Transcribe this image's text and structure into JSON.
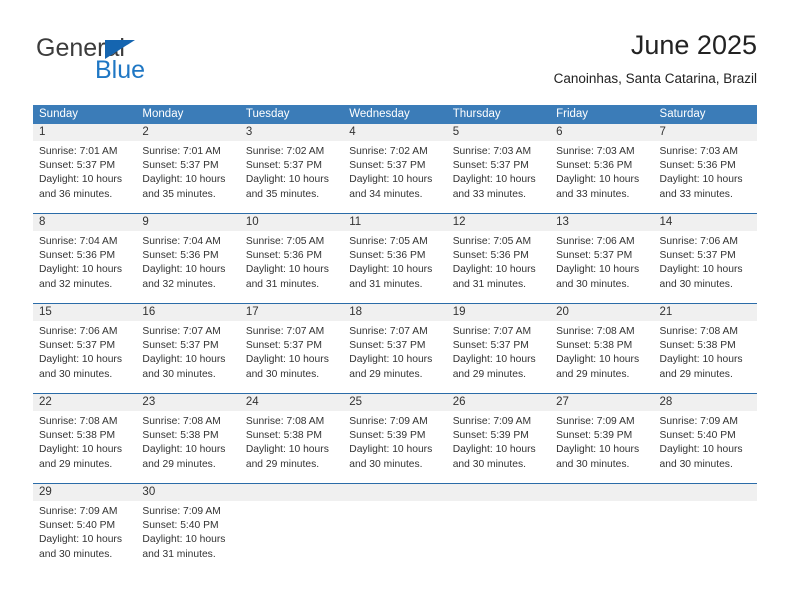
{
  "branding": {
    "logo_primary": "General",
    "logo_secondary": "Blue",
    "triangle_icon": "triangle-icon",
    "primary_color": "#3c3c3c",
    "accent_color": "#1f77c4"
  },
  "header": {
    "title": "June 2025",
    "subtitle": "Canoinhas, Santa Catarina, Brazil"
  },
  "theme": {
    "header_bar_color": "#3b7cb8",
    "week_separator_color": "#2b6ca8",
    "day_strip_color": "#f0f0f0",
    "text_color": "#333333"
  },
  "weekdays": [
    "Sunday",
    "Monday",
    "Tuesday",
    "Wednesday",
    "Thursday",
    "Friday",
    "Saturday"
  ],
  "weeks": [
    [
      {
        "day": "1",
        "sunrise": "Sunrise: 7:01 AM",
        "sunset": "Sunset: 5:37 PM",
        "daylight_line1": "Daylight: 10 hours",
        "daylight_line2": "and 36 minutes."
      },
      {
        "day": "2",
        "sunrise": "Sunrise: 7:01 AM",
        "sunset": "Sunset: 5:37 PM",
        "daylight_line1": "Daylight: 10 hours",
        "daylight_line2": "and 35 minutes."
      },
      {
        "day": "3",
        "sunrise": "Sunrise: 7:02 AM",
        "sunset": "Sunset: 5:37 PM",
        "daylight_line1": "Daylight: 10 hours",
        "daylight_line2": "and 35 minutes."
      },
      {
        "day": "4",
        "sunrise": "Sunrise: 7:02 AM",
        "sunset": "Sunset: 5:37 PM",
        "daylight_line1": "Daylight: 10 hours",
        "daylight_line2": "and 34 minutes."
      },
      {
        "day": "5",
        "sunrise": "Sunrise: 7:03 AM",
        "sunset": "Sunset: 5:37 PM",
        "daylight_line1": "Daylight: 10 hours",
        "daylight_line2": "and 33 minutes."
      },
      {
        "day": "6",
        "sunrise": "Sunrise: 7:03 AM",
        "sunset": "Sunset: 5:36 PM",
        "daylight_line1": "Daylight: 10 hours",
        "daylight_line2": "and 33 minutes."
      },
      {
        "day": "7",
        "sunrise": "Sunrise: 7:03 AM",
        "sunset": "Sunset: 5:36 PM",
        "daylight_line1": "Daylight: 10 hours",
        "daylight_line2": "and 33 minutes."
      }
    ],
    [
      {
        "day": "8",
        "sunrise": "Sunrise: 7:04 AM",
        "sunset": "Sunset: 5:36 PM",
        "daylight_line1": "Daylight: 10 hours",
        "daylight_line2": "and 32 minutes."
      },
      {
        "day": "9",
        "sunrise": "Sunrise: 7:04 AM",
        "sunset": "Sunset: 5:36 PM",
        "daylight_line1": "Daylight: 10 hours",
        "daylight_line2": "and 32 minutes."
      },
      {
        "day": "10",
        "sunrise": "Sunrise: 7:05 AM",
        "sunset": "Sunset: 5:36 PM",
        "daylight_line1": "Daylight: 10 hours",
        "daylight_line2": "and 31 minutes."
      },
      {
        "day": "11",
        "sunrise": "Sunrise: 7:05 AM",
        "sunset": "Sunset: 5:36 PM",
        "daylight_line1": "Daylight: 10 hours",
        "daylight_line2": "and 31 minutes."
      },
      {
        "day": "12",
        "sunrise": "Sunrise: 7:05 AM",
        "sunset": "Sunset: 5:36 PM",
        "daylight_line1": "Daylight: 10 hours",
        "daylight_line2": "and 31 minutes."
      },
      {
        "day": "13",
        "sunrise": "Sunrise: 7:06 AM",
        "sunset": "Sunset: 5:37 PM",
        "daylight_line1": "Daylight: 10 hours",
        "daylight_line2": "and 30 minutes."
      },
      {
        "day": "14",
        "sunrise": "Sunrise: 7:06 AM",
        "sunset": "Sunset: 5:37 PM",
        "daylight_line1": "Daylight: 10 hours",
        "daylight_line2": "and 30 minutes."
      }
    ],
    [
      {
        "day": "15",
        "sunrise": "Sunrise: 7:06 AM",
        "sunset": "Sunset: 5:37 PM",
        "daylight_line1": "Daylight: 10 hours",
        "daylight_line2": "and 30 minutes."
      },
      {
        "day": "16",
        "sunrise": "Sunrise: 7:07 AM",
        "sunset": "Sunset: 5:37 PM",
        "daylight_line1": "Daylight: 10 hours",
        "daylight_line2": "and 30 minutes."
      },
      {
        "day": "17",
        "sunrise": "Sunrise: 7:07 AM",
        "sunset": "Sunset: 5:37 PM",
        "daylight_line1": "Daylight: 10 hours",
        "daylight_line2": "and 30 minutes."
      },
      {
        "day": "18",
        "sunrise": "Sunrise: 7:07 AM",
        "sunset": "Sunset: 5:37 PM",
        "daylight_line1": "Daylight: 10 hours",
        "daylight_line2": "and 29 minutes."
      },
      {
        "day": "19",
        "sunrise": "Sunrise: 7:07 AM",
        "sunset": "Sunset: 5:37 PM",
        "daylight_line1": "Daylight: 10 hours",
        "daylight_line2": "and 29 minutes."
      },
      {
        "day": "20",
        "sunrise": "Sunrise: 7:08 AM",
        "sunset": "Sunset: 5:38 PM",
        "daylight_line1": "Daylight: 10 hours",
        "daylight_line2": "and 29 minutes."
      },
      {
        "day": "21",
        "sunrise": "Sunrise: 7:08 AM",
        "sunset": "Sunset: 5:38 PM",
        "daylight_line1": "Daylight: 10 hours",
        "daylight_line2": "and 29 minutes."
      }
    ],
    [
      {
        "day": "22",
        "sunrise": "Sunrise: 7:08 AM",
        "sunset": "Sunset: 5:38 PM",
        "daylight_line1": "Daylight: 10 hours",
        "daylight_line2": "and 29 minutes."
      },
      {
        "day": "23",
        "sunrise": "Sunrise: 7:08 AM",
        "sunset": "Sunset: 5:38 PM",
        "daylight_line1": "Daylight: 10 hours",
        "daylight_line2": "and 29 minutes."
      },
      {
        "day": "24",
        "sunrise": "Sunrise: 7:08 AM",
        "sunset": "Sunset: 5:38 PM",
        "daylight_line1": "Daylight: 10 hours",
        "daylight_line2": "and 29 minutes."
      },
      {
        "day": "25",
        "sunrise": "Sunrise: 7:09 AM",
        "sunset": "Sunset: 5:39 PM",
        "daylight_line1": "Daylight: 10 hours",
        "daylight_line2": "and 30 minutes."
      },
      {
        "day": "26",
        "sunrise": "Sunrise: 7:09 AM",
        "sunset": "Sunset: 5:39 PM",
        "daylight_line1": "Daylight: 10 hours",
        "daylight_line2": "and 30 minutes."
      },
      {
        "day": "27",
        "sunrise": "Sunrise: 7:09 AM",
        "sunset": "Sunset: 5:39 PM",
        "daylight_line1": "Daylight: 10 hours",
        "daylight_line2": "and 30 minutes."
      },
      {
        "day": "28",
        "sunrise": "Sunrise: 7:09 AM",
        "sunset": "Sunset: 5:40 PM",
        "daylight_line1": "Daylight: 10 hours",
        "daylight_line2": "and 30 minutes."
      }
    ],
    [
      {
        "day": "29",
        "sunrise": "Sunrise: 7:09 AM",
        "sunset": "Sunset: 5:40 PM",
        "daylight_line1": "Daylight: 10 hours",
        "daylight_line2": "and 30 minutes."
      },
      {
        "day": "30",
        "sunrise": "Sunrise: 7:09 AM",
        "sunset": "Sunset: 5:40 PM",
        "daylight_line1": "Daylight: 10 hours",
        "daylight_line2": "and 31 minutes."
      },
      {
        "day": "",
        "sunrise": "",
        "sunset": "",
        "daylight_line1": "",
        "daylight_line2": ""
      },
      {
        "day": "",
        "sunrise": "",
        "sunset": "",
        "daylight_line1": "",
        "daylight_line2": ""
      },
      {
        "day": "",
        "sunrise": "",
        "sunset": "",
        "daylight_line1": "",
        "daylight_line2": ""
      },
      {
        "day": "",
        "sunrise": "",
        "sunset": "",
        "daylight_line1": "",
        "daylight_line2": ""
      },
      {
        "day": "",
        "sunrise": "",
        "sunset": "",
        "daylight_line1": "",
        "daylight_line2": ""
      }
    ]
  ]
}
